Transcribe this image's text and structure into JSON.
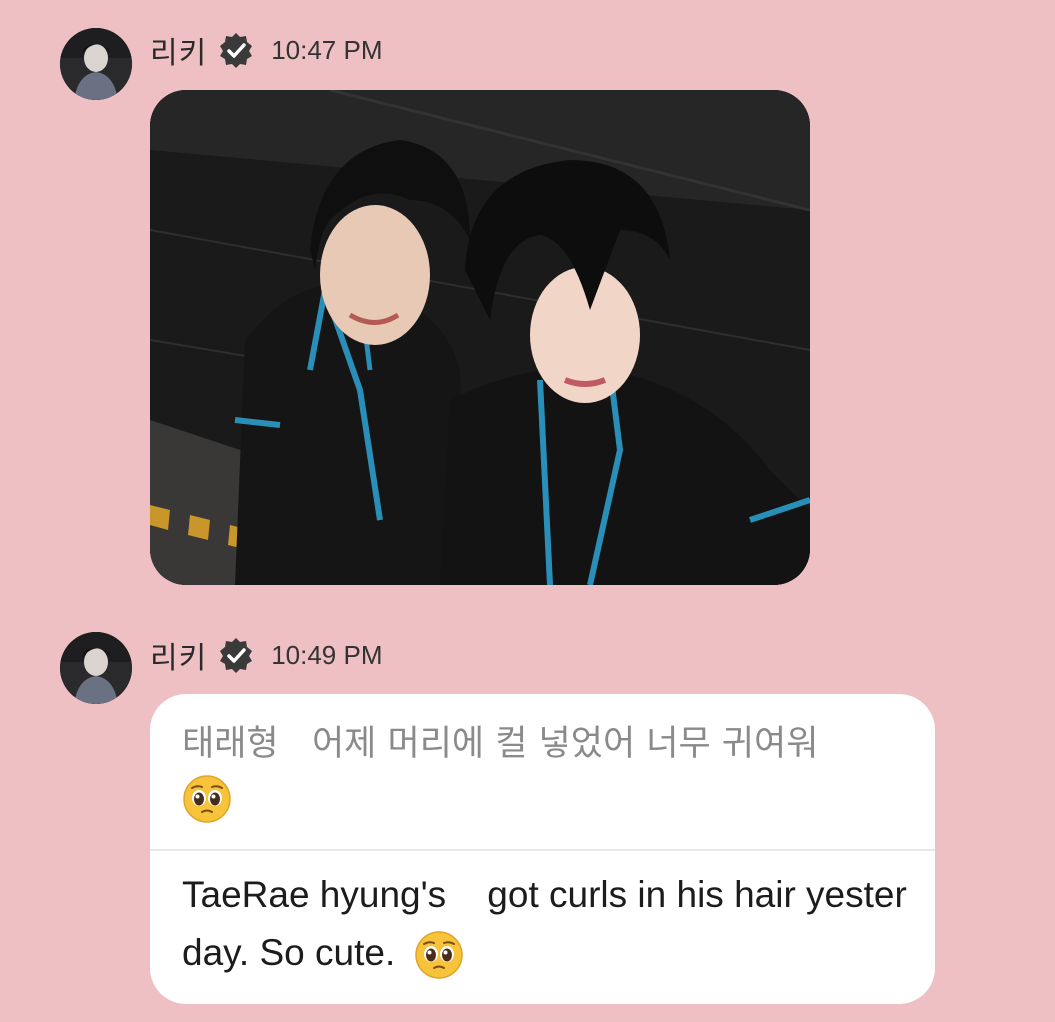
{
  "messages": [
    {
      "sender": "리키",
      "verified_icon": "verified-badge-icon",
      "time": "10:47 PM",
      "type": "photo",
      "photo_description_icon": "selfie-photo"
    },
    {
      "sender": "리키",
      "verified_icon": "verified-badge-icon",
      "time": "10:49 PM",
      "type": "text",
      "original_text": "태래형   어제 머리에 컬 넣었어 너무 귀여워",
      "original_emoji": "pleading-face-emoji",
      "translated_text": "TaeRae hyung's    got curls in his hair yesterday. So cute.",
      "translated_emoji": "pleading-face-emoji"
    }
  ],
  "colors": {
    "background": "#efc0c3",
    "bubble": "#ffffff",
    "original_text": "#8a8a8a",
    "translated_text": "#1c1c1c",
    "divider": "#e8e8e8"
  }
}
